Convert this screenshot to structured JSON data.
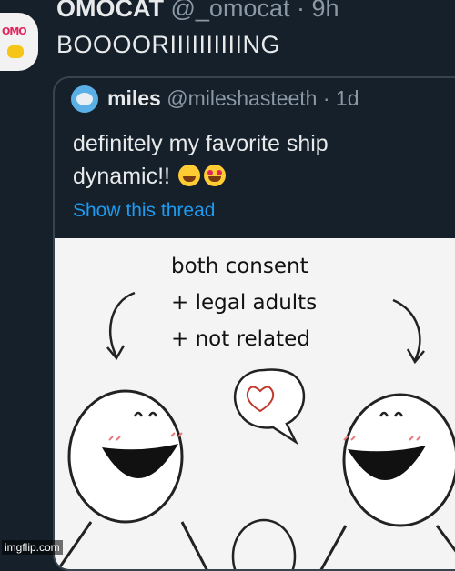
{
  "tweet": {
    "display_name": "OMOCAT",
    "handle_time": "@_omocat · 9h",
    "text": "BOOOORIIIIIIIIIING"
  },
  "quote": {
    "display_name": "miles",
    "handle_time": "@mileshasteeth · 1d",
    "text_line1": "definitely my favorite ship",
    "text_line2": "dynamic!!",
    "show_thread": "Show this thread",
    "emojis": [
      "smiling-face-with-hearts-icon",
      "heart-eyes-icon"
    ]
  },
  "meme": {
    "line1": "both consent",
    "line2": "+ legal adults",
    "line3": "+ not related"
  },
  "watermark": "imgflip.com",
  "colors": {
    "background": "#15202b",
    "text": "#e7e9ea",
    "muted": "#8b98a5",
    "link": "#1d9bf0",
    "border": "#38444d"
  }
}
